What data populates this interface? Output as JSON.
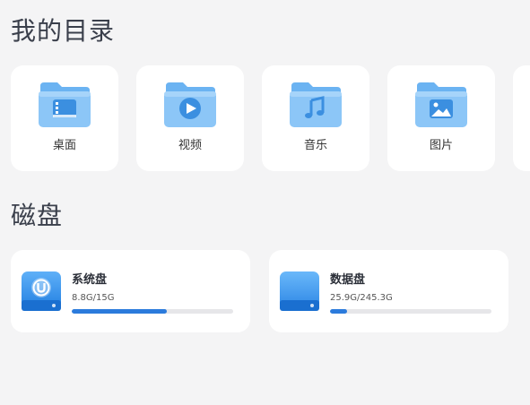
{
  "sections": {
    "directories_title": "我的目录",
    "disks_title": "磁盘"
  },
  "directories": [
    {
      "label": "桌面",
      "icon": "desktop-folder-icon"
    },
    {
      "label": "视频",
      "icon": "video-folder-icon"
    },
    {
      "label": "音乐",
      "icon": "music-folder-icon"
    },
    {
      "label": "图片",
      "icon": "picture-folder-icon"
    }
  ],
  "disks": [
    {
      "name": "系统盘",
      "usage": "8.8G/15G",
      "used_fraction": 0.59,
      "icon": "system-disk-icon"
    },
    {
      "name": "数据盘",
      "usage": "25.9G/245.3G",
      "used_fraction": 0.106,
      "icon": "data-disk-icon"
    }
  ],
  "colors": {
    "accent": "#2b7bdc",
    "folder_light": "#8cc6f7",
    "folder_dark": "#4a9fe6",
    "background": "#f4f4f5",
    "card": "#ffffff"
  }
}
